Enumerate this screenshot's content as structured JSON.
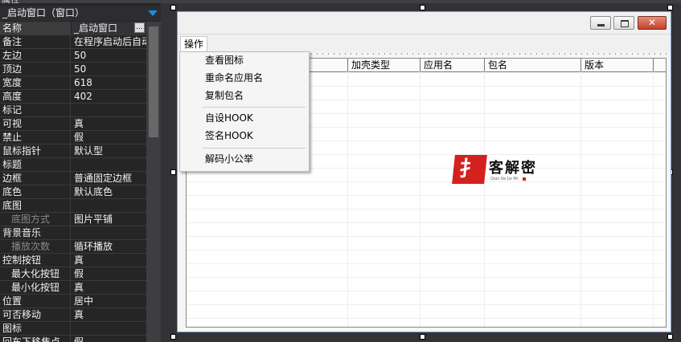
{
  "property_panel": {
    "top_label": "属性",
    "object_selector": "_启动窗口（窗口）",
    "rows": [
      {
        "name": "名称",
        "value": "_启动窗口",
        "selected": true
      },
      {
        "name": "备注",
        "value": "在程序启动后自动"
      },
      {
        "name": "左边",
        "value": "50"
      },
      {
        "name": "顶边",
        "value": "50"
      },
      {
        "name": "宽度",
        "value": "618"
      },
      {
        "name": "高度",
        "value": "402"
      },
      {
        "name": "标记",
        "value": ""
      },
      {
        "name": "可视",
        "value": "真"
      },
      {
        "name": "禁止",
        "value": "假"
      },
      {
        "name": "鼠标指针",
        "value": "默认型"
      },
      {
        "name": "标题",
        "value": ""
      },
      {
        "name": "边框",
        "value": "普通固定边框"
      },
      {
        "name": "底色",
        "value": "默认底色"
      },
      {
        "name": "底图",
        "value": ""
      },
      {
        "name": "底图方式",
        "value": "图片平铺",
        "sub": true,
        "dim": true
      },
      {
        "name": "背景音乐",
        "value": ""
      },
      {
        "name": "播放次数",
        "value": "循环播放",
        "sub": true,
        "dim": true
      },
      {
        "name": "控制按钮",
        "value": "真"
      },
      {
        "name": "最大化按钮",
        "value": "假",
        "sub": true
      },
      {
        "name": "最小化按钮",
        "value": "真",
        "sub": true
      },
      {
        "name": "位置",
        "value": "居中"
      },
      {
        "name": "可否移动",
        "value": "真"
      },
      {
        "name": "图标",
        "value": ""
      },
      {
        "name": "回车下移焦点",
        "value": "假"
      }
    ],
    "ellipsis_label": "..."
  },
  "form": {
    "close_glyph": "✕",
    "menu_label": "操作",
    "columns": [
      "加壳类型",
      "应用名",
      "包名",
      "版本"
    ]
  },
  "dropdown": {
    "group1": [
      "查看图标",
      "重命名应用名",
      "复制包名"
    ],
    "group2": [
      "自设HOOK",
      "签名HOOK"
    ],
    "group3": [
      "解码小公举"
    ]
  },
  "watermark": {
    "seal_char": "扌",
    "text": "客解密",
    "small": "Qian Ke Jie Mi"
  }
}
